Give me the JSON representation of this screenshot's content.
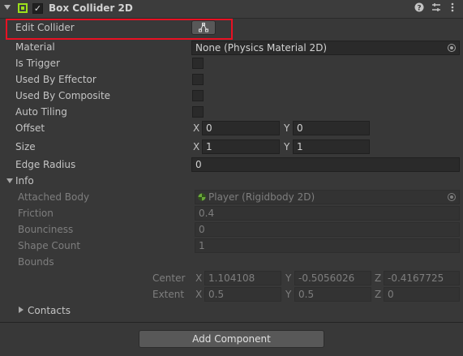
{
  "component": {
    "title": "Box Collider 2D",
    "help_icon": "help-icon",
    "presets_icon": "presets-icon",
    "menu_icon": "more-menu-icon",
    "enabled": true,
    "icon_color": "#9be01b"
  },
  "rows": {
    "edit_collider": "Edit Collider",
    "material": {
      "label": "Material",
      "value": "None (Physics Material 2D)"
    },
    "is_trigger": "Is Trigger",
    "used_by_effector": "Used By Effector",
    "used_by_composite": "Used By Composite",
    "auto_tiling": "Auto Tiling",
    "offset": {
      "label": "Offset",
      "x": "0",
      "y": "0"
    },
    "size": {
      "label": "Size",
      "x": "1",
      "y": "1"
    },
    "edge_radius": {
      "label": "Edge Radius",
      "value": "0"
    }
  },
  "info": {
    "label": "Info",
    "attached_body": {
      "label": "Attached Body",
      "value": "Player (Rigidbody 2D)"
    },
    "friction": {
      "label": "Friction",
      "value": "0.4"
    },
    "bounciness": {
      "label": "Bounciness",
      "value": "0"
    },
    "shape_count": {
      "label": "Shape Count",
      "value": "1"
    },
    "bounds": {
      "label": "Bounds",
      "center": {
        "label": "Center",
        "x": "1.104108",
        "y": "-0.5056026",
        "z": "-0.4167725"
      },
      "extent": {
        "label": "Extent",
        "x": "0.5",
        "y": "0.5",
        "z": "0"
      }
    },
    "contacts": "Contacts"
  },
  "axes": {
    "x": "X",
    "y": "Y",
    "z": "Z"
  },
  "add_component": "Add Component",
  "highlight_color": "#e81123"
}
